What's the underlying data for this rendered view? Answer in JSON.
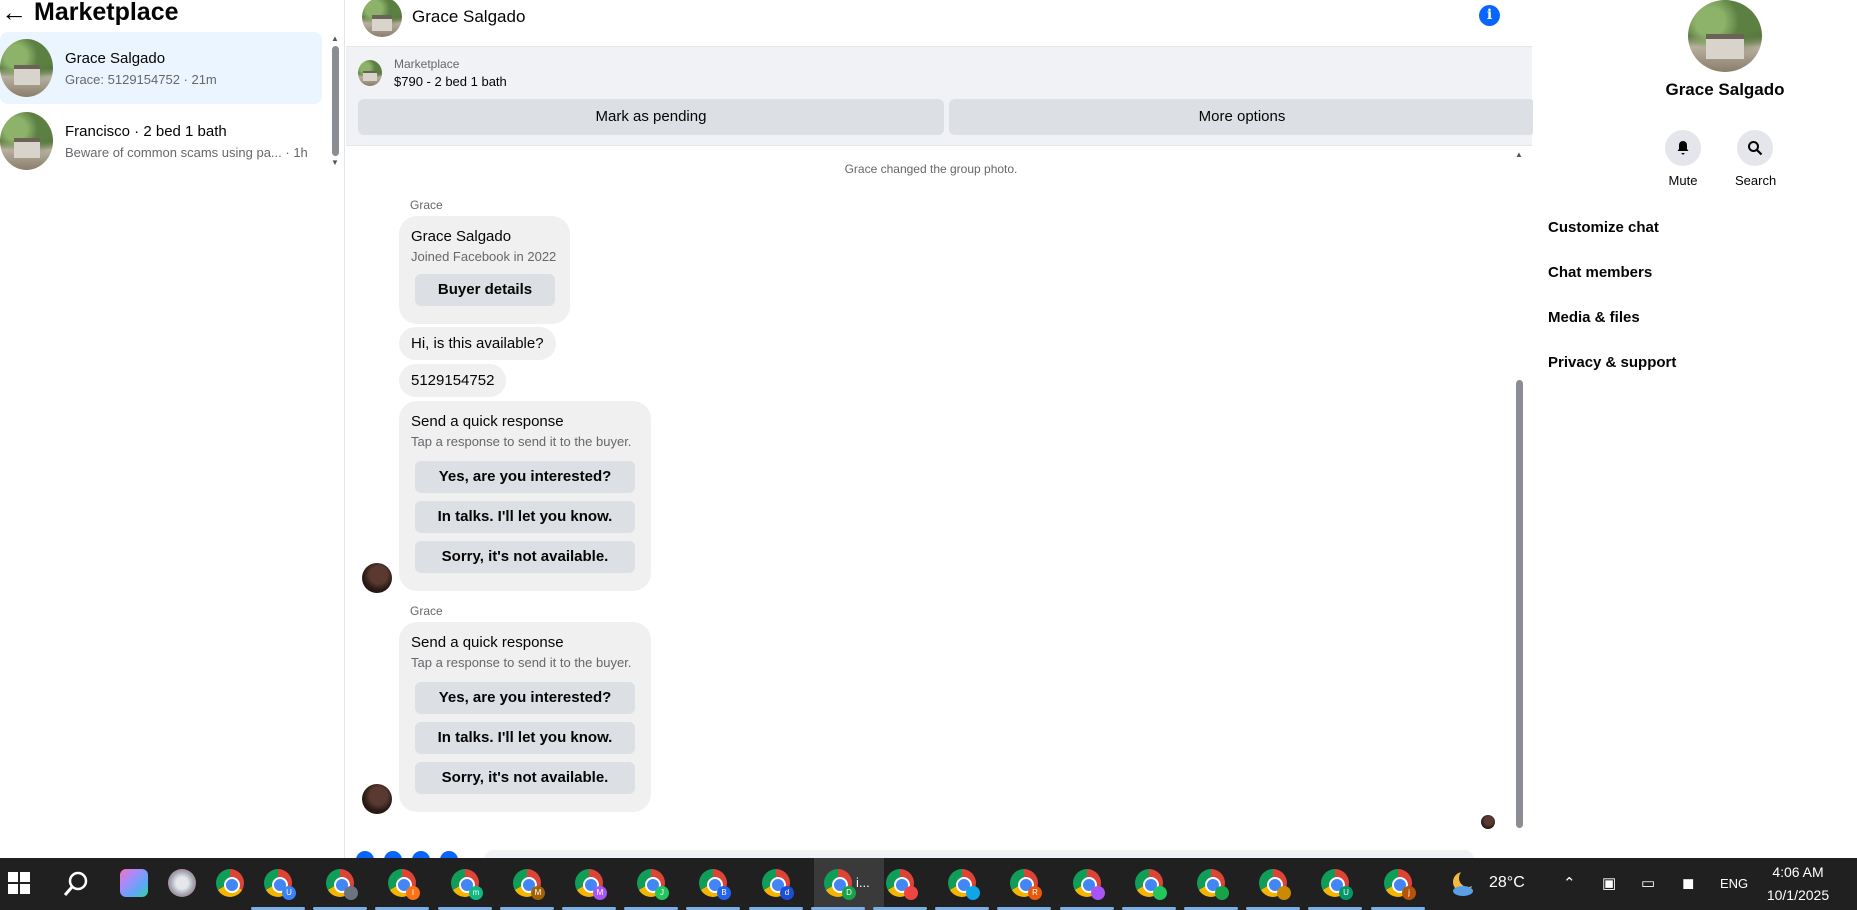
{
  "left": {
    "title": "Marketplace",
    "conversations": [
      {
        "name": "Grace Salgado",
        "subtitle": "Grace: 5129154752 · 21m"
      },
      {
        "name": "Francisco · 2 bed 1 bath",
        "subtitle": "Beware of common scams using pa... · 1h"
      }
    ]
  },
  "chat": {
    "header_name": "Grace Salgado",
    "listing_label": "Marketplace",
    "listing_title": "$790 - 2 bed 1 bath",
    "mark_pending_label": "Mark as pending",
    "more_options_label": "More options",
    "system_note": "Grace changed the group photo.",
    "sender_1": "Grace",
    "profile_card": {
      "name": "Grace Salgado",
      "sub": "Joined Facebook in 2022",
      "button": "Buyer details"
    },
    "message_1": "Hi, is this available?",
    "message_2": "5129154752",
    "quick_1": {
      "title": "Send a quick response",
      "sub": "Tap a response to send it to the buyer.",
      "options": [
        "Yes, are you interested?",
        "In talks. I'll let you know.",
        "Sorry, it's not available."
      ]
    },
    "sender_2": "Grace",
    "quick_2": {
      "title": "Send a quick response",
      "sub": "Tap a response to send it to the buyer.",
      "options": [
        "Yes, are you interested?",
        "In talks. I'll let you know.",
        "Sorry, it's not available."
      ]
    }
  },
  "right": {
    "name": "Grace Salgado",
    "mute_label": "Mute",
    "search_label": "Search",
    "menu": [
      "Customize chat",
      "Chat members",
      "Media & files",
      "Privacy & support"
    ]
  },
  "taskbar": {
    "active_label": "i...",
    "temperature": "28°C",
    "language": "ENG",
    "time": "4:06 AM",
    "date": "10/1/2025",
    "badges": [
      "U",
      "",
      "I",
      "m",
      "M",
      "M",
      "J",
      "B",
      "d",
      "D",
      "",
      "",
      "R",
      "",
      "",
      "",
      "",
      "U",
      "j"
    ]
  },
  "colors": {
    "accent": "#0866ff",
    "active_conversation": "#ebf5ff",
    "bubble": "#f0f0f0",
    "taskbar": "#202020"
  }
}
